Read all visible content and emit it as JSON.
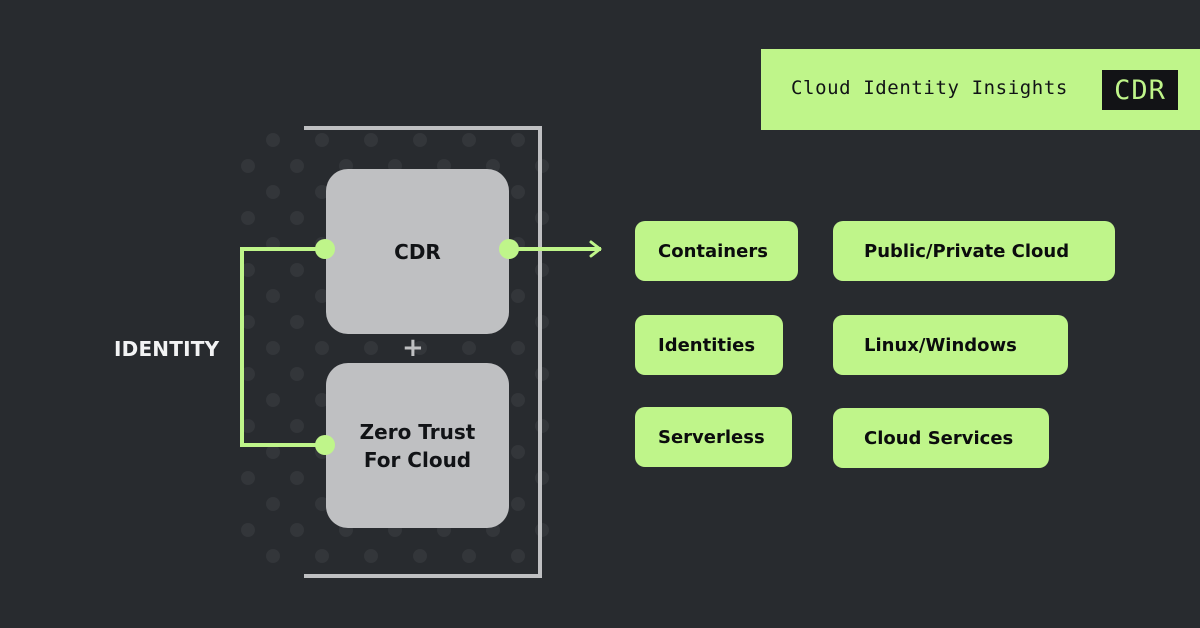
{
  "colors": {
    "background": "#282b2f",
    "accent_green": "#bff58a",
    "node_gray": "#bfc0c2",
    "dot_pattern": "#33363a",
    "text_dark": "#111316",
    "text_light": "#f2f3f4"
  },
  "banner": {
    "title": "Cloud Identity Insights",
    "badge": "CDR"
  },
  "diagram": {
    "side_label": "IDENTITY",
    "nodes": [
      {
        "id": "cdr",
        "label": "CDR"
      },
      {
        "id": "zero-trust",
        "label": "Zero Trust For Cloud"
      }
    ],
    "combinator": "+",
    "targets": [
      "Containers",
      "Public/Private Cloud",
      "Identities",
      "Linux/Windows",
      "Serverless",
      "Cloud Services"
    ]
  }
}
